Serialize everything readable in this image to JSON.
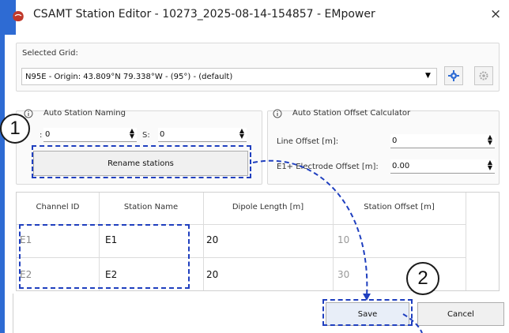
{
  "window": {
    "title": "CSAMT Station Editor - 10273_2025-08-14-154857 - EMpower",
    "close_glyph": "×"
  },
  "grid": {
    "label": "Selected Grid:",
    "value": "N95E - Origin: 43.809°N 79.338°W - (95°) - (default)"
  },
  "naming": {
    "title": "Auto Station Naming",
    "prefix_label": ":",
    "prefix_value": "0",
    "s_label": "S:",
    "s_value": "0",
    "rename_label": "Rename stations"
  },
  "offset": {
    "title": "Auto Station Offset Calculator",
    "line_label": "Line Offset [m]:",
    "line_value": "0",
    "electrode_label": "E1+ Electrode Offset [m]:",
    "electrode_value": "0.00"
  },
  "table": {
    "headers": [
      "Channel ID",
      "Station Name",
      "Dipole Length [m]",
      "Station Offset [m]"
    ],
    "rows": [
      {
        "channel": "E1",
        "station": "E1",
        "dipole": "20",
        "offset": "10"
      },
      {
        "channel": "E2",
        "station": "E2",
        "dipole": "20",
        "offset": "30"
      }
    ]
  },
  "buttons": {
    "save": "Save",
    "cancel": "Cancel"
  },
  "callouts": [
    "1",
    "2"
  ],
  "colors": {
    "accent_blue": "#2e6bd3",
    "dash_blue": "#1f3fbf",
    "app_icon_red": "#c0392b"
  }
}
